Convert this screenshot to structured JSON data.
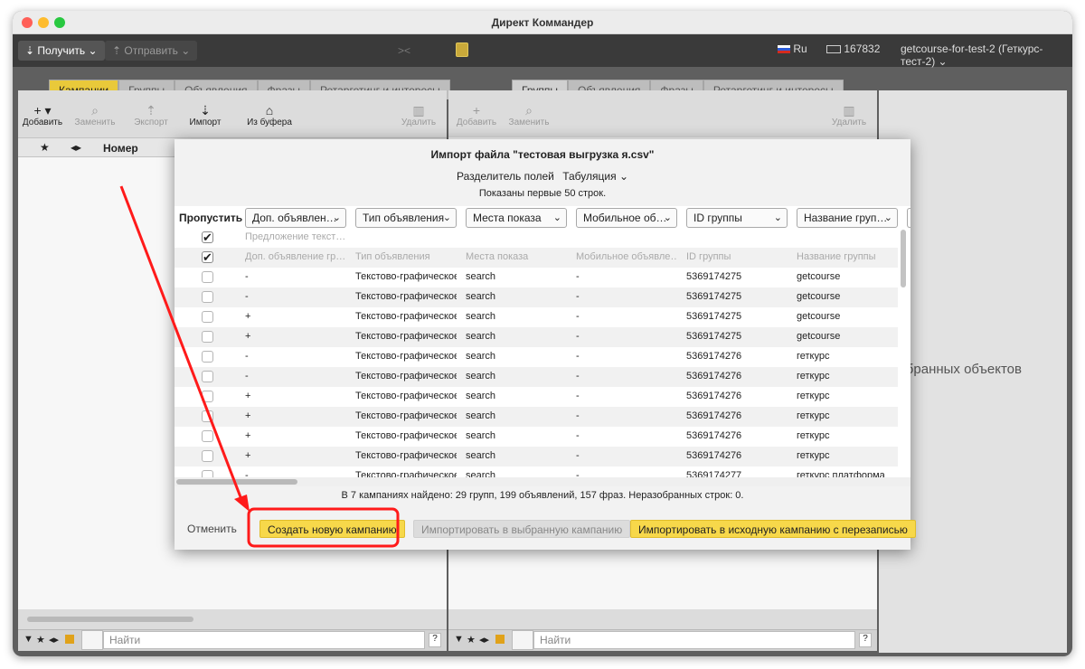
{
  "window": {
    "title": "Директ Коммандер"
  },
  "toolbar": {
    "get_label": "Получить",
    "send_label": "Отправить",
    "lang": "Ru",
    "balance": "167832",
    "account": "getcourse-for-test-2 (Геткурс-тест-2)"
  },
  "left_panel": {
    "tabs": [
      "Кампании",
      "Группы",
      "Объявления",
      "Фразы",
      "Ретаргетинг и интересы"
    ],
    "tools": [
      {
        "icon": "plus-icon",
        "label": "Добавить",
        "enabled": true
      },
      {
        "icon": "search-icon",
        "label": "Заменить",
        "enabled": false
      },
      {
        "icon": "export-icon",
        "label": "Экспорт",
        "enabled": false
      },
      {
        "icon": "import-icon",
        "label": "Импорт",
        "enabled": true
      },
      {
        "icon": "clipboard-icon",
        "label": "Из буфера",
        "enabled": true
      },
      {
        "icon": "trash-icon",
        "label": "Удалить",
        "enabled": false
      }
    ],
    "table_header": {
      "number": "Номер"
    },
    "search_placeholder": "Найти",
    "help": "?"
  },
  "middle_panel": {
    "tabs": [
      "Группы",
      "Объявления",
      "Фразы",
      "Ретаргетинг и интересы"
    ],
    "tools": [
      {
        "icon": "plus-icon",
        "label": "Добавить",
        "enabled": false
      },
      {
        "icon": "search-icon",
        "label": "Заменить",
        "enabled": false
      },
      {
        "icon": "trash-icon",
        "label": "Удалить",
        "enabled": false
      }
    ],
    "search_placeholder": "Найти",
    "help": "?"
  },
  "right_panel": {
    "empty_text": "т выбранных объектов"
  },
  "dialog": {
    "title": "Импорт файла \"тестовая выгрузка я.csv\"",
    "separator_label": "Разделитель полей",
    "separator_value": "Табуляция",
    "shown_rows": "Показаны первые 50 строк.",
    "skip_header": "Пропустить",
    "columns": [
      "Доп. объявлен…",
      "Тип объявления",
      "Места показа",
      "Мобильное об…",
      "ID группы",
      "Название груп…"
    ],
    "header_rows": [
      {
        "checked": true,
        "cells": [
          "Предложение текст…",
          "",
          "",
          "",
          "",
          ""
        ]
      },
      {
        "checked": true,
        "cells": [
          "Доп. объявление гр…",
          "Тип объявления",
          "Места показа",
          "Мобильное объявле…",
          "ID группы",
          "Название группы"
        ]
      }
    ],
    "rows": [
      [
        "-",
        "Текстово-графическое",
        "search",
        "-",
        "5369174275",
        "getcourse"
      ],
      [
        "-",
        "Текстово-графическое",
        "search",
        "-",
        "5369174275",
        "getcourse"
      ],
      [
        "+",
        "Текстово-графическое",
        "search",
        "-",
        "5369174275",
        "getcourse"
      ],
      [
        "+",
        "Текстово-графическое",
        "search",
        "-",
        "5369174275",
        "getcourse"
      ],
      [
        "-",
        "Текстово-графическое",
        "search",
        "-",
        "5369174276",
        "геткурс"
      ],
      [
        "-",
        "Текстово-графическое",
        "search",
        "-",
        "5369174276",
        "геткурс"
      ],
      [
        "+",
        "Текстово-графическое",
        "search",
        "-",
        "5369174276",
        "геткурс"
      ],
      [
        "+",
        "Текстово-графическое",
        "search",
        "-",
        "5369174276",
        "геткурс"
      ],
      [
        "+",
        "Текстово-графическое",
        "search",
        "-",
        "5369174276",
        "геткурс"
      ],
      [
        "+",
        "Текстово-графическое",
        "search",
        "-",
        "5369174276",
        "геткурс"
      ],
      [
        "-",
        "Текстово-графическое",
        "search",
        "-",
        "5369174277",
        "геткурс платформа"
      ]
    ],
    "summary": "В 7 кампаниях найдено: 29 групп, 199 объявлений, 157 фраз. Неразобранных строк: 0.",
    "cancel_label": "Отменить",
    "create_label": "Создать новую кампанию",
    "import_selected_label": "Импортировать в выбранную кампанию",
    "import_source_label": "Импортировать в исходную кампанию с перезаписью"
  },
  "colors": {
    "accent": "#f7d84a",
    "tab_active": "#e9c93a",
    "annotation": "#ff1a1a",
    "toolbar": "#3a3a3a"
  }
}
